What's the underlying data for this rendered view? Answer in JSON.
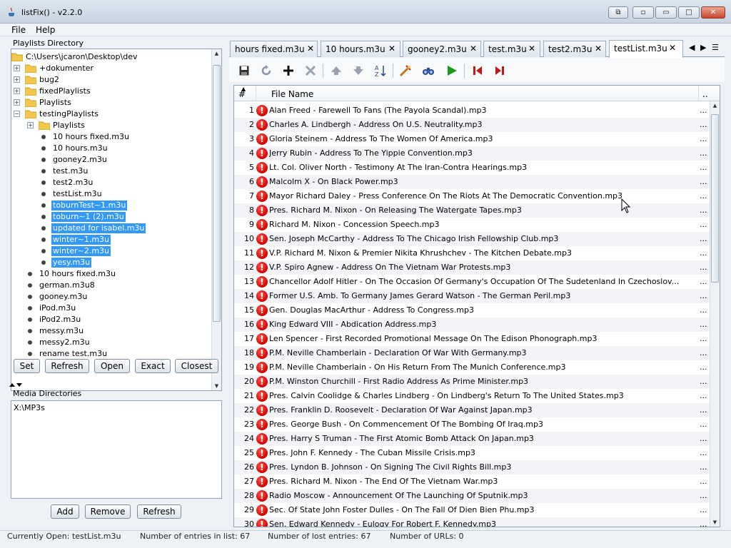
{
  "window": {
    "title": "listFix() - v2.2.0"
  },
  "menu": [
    "File",
    "Help"
  ],
  "playlists_directory": {
    "label": "Playlists Directory",
    "root": "C:\\Users\\jcaron\\Desktop\\dev",
    "items": [
      {
        "label": "+dokumenter",
        "type": "folder",
        "expander": "+",
        "level": 1,
        "selected": false
      },
      {
        "label": "bug2",
        "type": "folder",
        "expander": "+",
        "level": 1,
        "selected": false
      },
      {
        "label": "fixedPlaylists",
        "type": "folder",
        "expander": "+",
        "level": 1,
        "selected": false
      },
      {
        "label": "Playlists",
        "type": "folder",
        "expander": "+",
        "level": 1,
        "selected": false
      },
      {
        "label": "testingPlaylists",
        "type": "folder",
        "expander": "−",
        "level": 1,
        "selected": false
      },
      {
        "label": "Playlists",
        "type": "folder",
        "expander": "+",
        "level": 2,
        "selected": false
      },
      {
        "label": "10 hours fixed.m3u",
        "type": "file",
        "level": 2,
        "selected": false
      },
      {
        "label": "10 hours.m3u",
        "type": "file",
        "level": 2,
        "selected": false
      },
      {
        "label": "gooney2.m3u",
        "type": "file",
        "level": 2,
        "selected": false
      },
      {
        "label": "test.m3u",
        "type": "file",
        "level": 2,
        "selected": false
      },
      {
        "label": "test2.m3u",
        "type": "file",
        "level": 2,
        "selected": false
      },
      {
        "label": "testList.m3u",
        "type": "file",
        "level": 2,
        "selected": false
      },
      {
        "label": "toburnTest~1.m3u",
        "type": "file",
        "level": 2,
        "selected": true
      },
      {
        "label": "toburn~1 (2).m3u",
        "type": "file",
        "level": 2,
        "selected": true
      },
      {
        "label": "updated for isabel.m3u",
        "type": "file",
        "level": 2,
        "selected": true
      },
      {
        "label": "winter~1.m3u",
        "type": "file",
        "level": 2,
        "selected": true
      },
      {
        "label": "winter~2.m3u",
        "type": "file",
        "level": 2,
        "selected": true
      },
      {
        "label": "yesy.m3u",
        "type": "file",
        "level": 2,
        "selected": true
      },
      {
        "label": "10 hours fixed.m3u",
        "type": "file",
        "level": 1,
        "selected": false
      },
      {
        "label": "german.m3u8",
        "type": "file",
        "level": 1,
        "selected": false
      },
      {
        "label": "gooney.m3u",
        "type": "file",
        "level": 1,
        "selected": false
      },
      {
        "label": "iPod.m3u",
        "type": "file",
        "level": 1,
        "selected": false
      },
      {
        "label": "iPod2.m3u",
        "type": "file",
        "level": 1,
        "selected": false
      },
      {
        "label": "messy.m3u",
        "type": "file",
        "level": 1,
        "selected": false
      },
      {
        "label": "messy2.m3u",
        "type": "file",
        "level": 1,
        "selected": false
      },
      {
        "label": "rename test.m3u",
        "type": "file",
        "level": 1,
        "selected": false
      }
    ],
    "buttons": [
      "Set",
      "Refresh",
      "Open",
      "Exact",
      "Closest"
    ]
  },
  "media_directories": {
    "label": "Media Directories",
    "items": [
      "X:\\MP3s"
    ],
    "buttons": [
      "Add",
      "Remove",
      "Refresh"
    ]
  },
  "tabs": [
    {
      "label": "hours fixed.m3u",
      "active": false
    },
    {
      "label": "10 hours.m3u",
      "active": false
    },
    {
      "label": "gooney2.m3u",
      "active": false
    },
    {
      "label": "test.m3u",
      "active": false
    },
    {
      "label": "test2.m3u",
      "active": false
    },
    {
      "label": "testList.m3u",
      "active": true
    }
  ],
  "toolbar_icons": [
    "save-icon",
    "reload-icon",
    "add-icon",
    "remove-icon",
    "move-up-icon",
    "move-down-icon",
    "sort-icon",
    "repair-icon",
    "find-icon",
    "play-icon",
    "first-lost-icon",
    "next-lost-icon"
  ],
  "table": {
    "headers": {
      "num": "#",
      "file": "File Name",
      "more": ".."
    },
    "rows": [
      {
        "n": "1",
        "file": "Alan Freed - Farewell To Fans (The Payola Scandal).mp3"
      },
      {
        "n": "2",
        "file": "Charles A. Lindbergh - Address On U.S. Neutrality.mp3"
      },
      {
        "n": "3",
        "file": "Gloria Steinem - Address To The Women Of America.mp3"
      },
      {
        "n": "4",
        "file": "Jerry Rubin - Address To The Yippie Convention.mp3"
      },
      {
        "n": "5",
        "file": "Lt. Col. Oliver North - Testimony At The Iran-Contra Hearings.mp3"
      },
      {
        "n": "6",
        "file": "Malcolm X - On Black Power.mp3"
      },
      {
        "n": "7",
        "file": "Mayor Richard Daley - Press Conference On The Riots At The Democratic Convention.mp3"
      },
      {
        "n": "8",
        "file": "Pres. Richard M. Nixon - On Releasing The Watergate Tapes.mp3"
      },
      {
        "n": "9",
        "file": "Richard M. Nixon - Concession Speech.mp3"
      },
      {
        "n": "10",
        "file": "Sen. Joseph McCarthy - Address To The Chicago Irish Fellowship Club.mp3"
      },
      {
        "n": "11",
        "file": "V.P. Richard M. Nixon & Premier Nikita Khrushchev - The Kitchen Debate.mp3"
      },
      {
        "n": "12",
        "file": "V.P. Spiro Agnew - Address On The Vietnam War Protests.mp3"
      },
      {
        "n": "13",
        "file": "Chancellor Adolf Hitler - On The Occasion Of Germany's Occupation Of The Sudetenland In Czechoslov..."
      },
      {
        "n": "14",
        "file": "Former U.S. Amb. To Germany James Gerard Watson - The German Peril.mp3"
      },
      {
        "n": "15",
        "file": "Gen. Douglas MacArthur - Address To Congress.mp3"
      },
      {
        "n": "16",
        "file": "King Edward VIII - Abdication Address.mp3"
      },
      {
        "n": "17",
        "file": "Len Spencer - First Recorded Promotional Message On The Edison Phonograph.mp3"
      },
      {
        "n": "18",
        "file": "P.M. Neville Chamberlain - Declaration Of War With Germany.mp3"
      },
      {
        "n": "19",
        "file": "P.M. Neville Chamberlain - On His Return From The Munich Conference.mp3"
      },
      {
        "n": "20",
        "file": "P.M. Winston Churchill - First Radio Address As Prime Minister.mp3"
      },
      {
        "n": "21",
        "file": "Pres. Calvin Coolidge & Charles Lindberg - On Lindberg's Return To The United States.mp3"
      },
      {
        "n": "22",
        "file": "Pres. Franklin D. Roosevelt - Declaration Of War Against Japan.mp3"
      },
      {
        "n": "23",
        "file": "Pres. George Bush - On Commencement Of The Bombing Of Iraq.mp3"
      },
      {
        "n": "24",
        "file": "Pres. Harry S Truman - The First Atomic Bomb Attack On Japan.mp3"
      },
      {
        "n": "25",
        "file": "Pres. John F. Kennedy - The Cuban Missile Crisis.mp3"
      },
      {
        "n": "26",
        "file": "Pres. Lyndon B. Johnson - On Signing The Civil Rights Bill.mp3"
      },
      {
        "n": "27",
        "file": "Pres. Richard M. Nixon - The End Of The Vietnam War.mp3"
      },
      {
        "n": "28",
        "file": "Radio Moscow - Announcement Of The Launching Of Sputnik.mp3"
      },
      {
        "n": "29",
        "file": "Sec. Of State John Foster Dulles - On The Fall Of Dien Bien Phu.mp3"
      },
      {
        "n": "30",
        "file": "Sen. Edward Kennedy - Eulogy For Robert F. Kennedy.mp3"
      }
    ],
    "more_cell": "..."
  },
  "status": {
    "currently_open": "Currently Open: testList.m3u",
    "entries": "Number of entries in list: 67",
    "lost": "Number of lost entries: 67",
    "urls": "Number of URLs: 0"
  }
}
